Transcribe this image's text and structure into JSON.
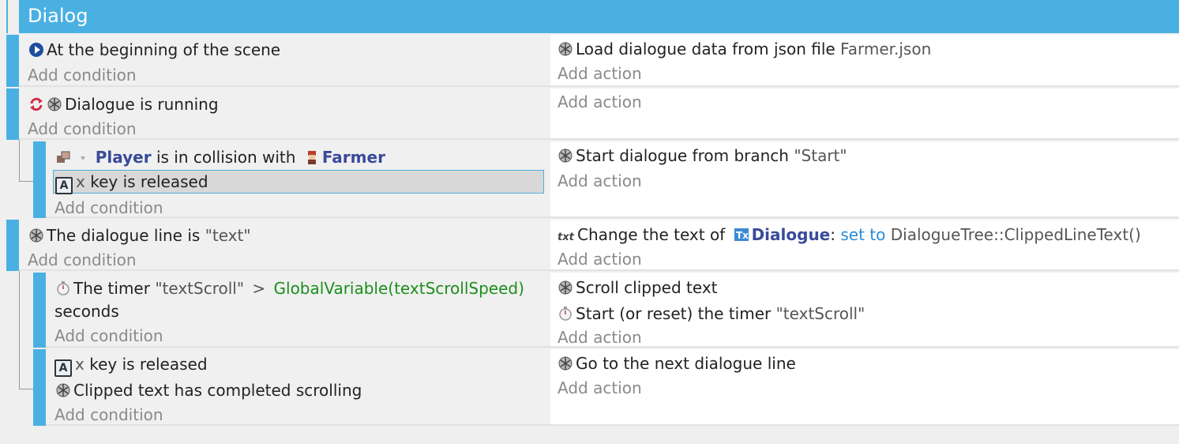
{
  "group": {
    "title": "Dialog"
  },
  "events": {
    "e1": {
      "condition": "At the beginning of the scene",
      "add_condition": "Add condition",
      "action": {
        "text": "Load dialogue data from json file",
        "param": "Farmer.json"
      },
      "add_action": "Add action"
    },
    "e2": {
      "condition": "Dialogue is running",
      "add_condition": "Add condition",
      "add_action": "Add action"
    },
    "e3": {
      "cond1": {
        "object": "Player",
        "middle": "is in collision with",
        "object2": "Farmer"
      },
      "cond2": {
        "key": "x",
        "text": "key is released"
      },
      "add_condition": "Add condition",
      "action": {
        "text": "Start dialogue from branch",
        "param": "\"Start\""
      },
      "add_action": "Add action"
    },
    "e4": {
      "condition": {
        "text": "The dialogue line is",
        "param": "\"text\""
      },
      "add_condition": "Add condition",
      "action": {
        "prefix": "Change the text of",
        "object": "Dialogue",
        "colon": ":",
        "op": "set to",
        "value": "DialogueTree::ClippedLineText()"
      },
      "add_action": "Add action"
    },
    "e5": {
      "condition": {
        "text": "The timer",
        "param": "\"textScroll\"",
        "op": ">",
        "expr": "GlobalVariable(textScrollSpeed)",
        "suffix": "seconds"
      },
      "add_condition": "Add condition",
      "action1": "Scroll clipped text",
      "action2": {
        "text": "Start (or reset) the timer",
        "param": "\"textScroll\""
      },
      "add_action": "Add action"
    },
    "e6": {
      "cond1": {
        "key": "x",
        "text": "key is released"
      },
      "cond2": "Clipped text has completed scrolling",
      "add_condition": "Add condition",
      "action": "Go to the next dialogue line",
      "add_action": "Add action"
    }
  },
  "icons": {
    "start": "scene-start-icon",
    "dialogue": "dialogue-tree-icon",
    "loop": "repeat-icon",
    "collision": "collision-icon",
    "farmer": "farmer-sprite-icon",
    "key": "keyboard-key-icon",
    "timer": "timer-icon",
    "text": "text-icon",
    "textobj": "text-object-icon"
  },
  "colors": {
    "accent": "#4ab0e2",
    "object": "#3a4a9a",
    "link": "#2a8ad8",
    "expr": "#1a8f1a"
  }
}
